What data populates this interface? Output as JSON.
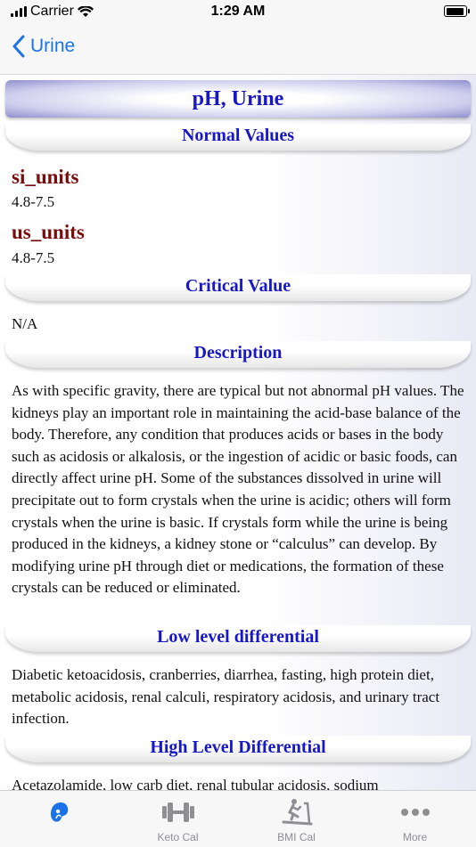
{
  "status_bar": {
    "carrier": "Carrier",
    "time": "1:29 AM"
  },
  "nav": {
    "back_label": "Urine"
  },
  "page": {
    "title": "pH, Urine",
    "sections": {
      "normal_values": "Normal Values",
      "critical_value": "Critical Value",
      "description": "Description",
      "low_level": "Low level differential",
      "high_level": "High Level Differential"
    },
    "si_units_label": "si_units",
    "si_units_value": "4.8-7.5",
    "us_units_label": "us_units",
    "us_units_value": "4.8-7.5",
    "critical_value_text": "N/A",
    "description_text": "As with specific gravity, there are typical but not abnormal pH values. The kidneys play an important role in maintaining the acid-base balance of the body. Therefore, any condition that produces acids or bases in the body such as acidosis or alkalosis, or the ingestion of acidic or basic foods, can directly affect urine pH. Some of the substances dissolved in urine will precipitate out to form crystals when the urine is acidic; others will form crystals when the urine is basic. If crystals form while the urine is being produced in the kidneys, a kidney stone or “calculus” can develop. By modifying urine pH through diet or medications, the formation of these crystals can be reduced or eliminated.",
    "low_level_text": "Diabetic ketoacidosis, cranberries, diarrhea, fasting, high protein diet, metabolic acidosis, renal calculi, respiratory acidosis, and urinary tract infection.",
    "high_level_text_partial": "Acetazolamide, low carb diet, renal tubular acidosis, sodium"
  },
  "tabs": [
    {
      "label": "",
      "icon": "kidney-icon",
      "active": true
    },
    {
      "label": "Keto Cal",
      "icon": "dumbbell-icon"
    },
    {
      "label": "BMI Cal",
      "icon": "treadmill-icon"
    },
    {
      "label": "More",
      "icon": "more-dots-icon"
    }
  ],
  "colors": {
    "accent": "#1a73e8",
    "header_text": "#1717c8",
    "unit_label": "#7a0c0c"
  }
}
